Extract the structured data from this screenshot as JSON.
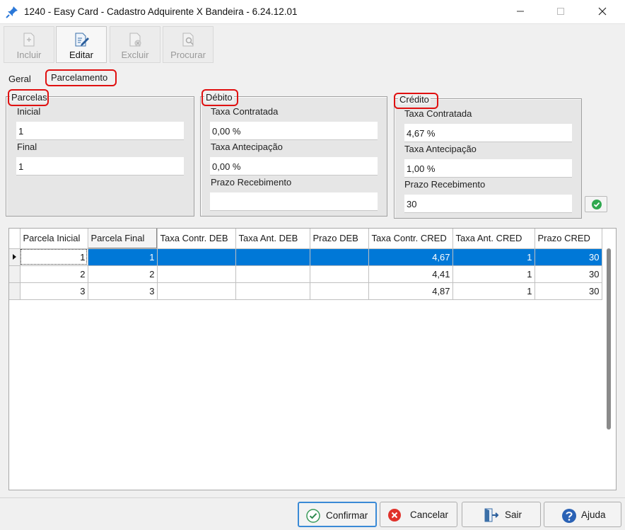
{
  "window": {
    "title": "1240 - Easy Card - Cadastro Adquirente X Bandeira - 6.24.12.01"
  },
  "toolbar": {
    "incluir": "Incluir",
    "editar": "Editar",
    "excluir": "Excluir",
    "procurar": "Procurar"
  },
  "tabs": {
    "geral": "Geral",
    "parcelamento": "Parcelamento"
  },
  "parcelas": {
    "legend": "Parcelas",
    "inicial_label": "Inicial",
    "inicial_value": "1",
    "final_label": "Final",
    "final_value": "1"
  },
  "debito": {
    "legend": "Débito",
    "taxa_contratada_label": "Taxa Contratada",
    "taxa_contratada_value": "0,00 %",
    "taxa_antecipacao_label": "Taxa Antecipação",
    "taxa_antecipacao_value": "0,00 %",
    "prazo_label": "Prazo Recebimento",
    "prazo_value": ""
  },
  "credito": {
    "legend": "Crédito",
    "taxa_contratada_label": "Taxa Contratada",
    "taxa_contratada_value": "4,67 %",
    "taxa_antecipacao_label": "Taxa Antecipação",
    "taxa_antecipacao_value": "1,00 %",
    "prazo_label": "Prazo Recebimento",
    "prazo_value": "30"
  },
  "grid": {
    "columns": [
      "Parcela Inicial",
      "Parcela Final",
      "Taxa Contr. DEB",
      "Taxa Ant. DEB",
      "Prazo DEB",
      "Taxa Contr. CRED",
      "Taxa Ant. CRED",
      "Prazo CRED"
    ],
    "rows": [
      [
        "1",
        "1",
        "",
        "",
        "",
        "4,67",
        "1",
        "30"
      ],
      [
        "2",
        "2",
        "",
        "",
        "",
        "4,41",
        "1",
        "30"
      ],
      [
        "3",
        "3",
        "",
        "",
        "",
        "4,87",
        "1",
        "30"
      ]
    ]
  },
  "buttons": {
    "confirmar": "Confirmar",
    "cancelar": "Cancelar",
    "sair": "Sair",
    "ajuda": "Ajuda"
  },
  "colors": {
    "selection": "#0078d7",
    "highlight": "#e01010"
  }
}
